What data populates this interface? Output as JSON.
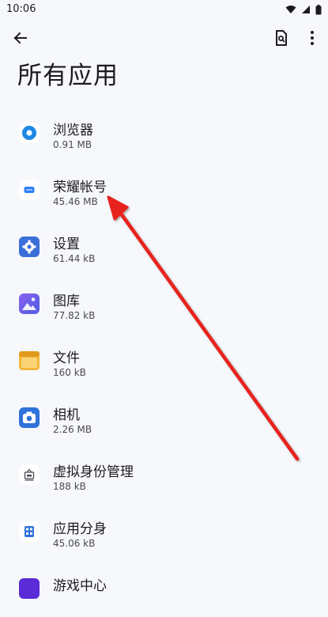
{
  "status_bar": {
    "time": "10:06"
  },
  "toolbar": {
    "back_icon": "arrow-left-icon",
    "search_icon": "search-document-icon",
    "more_icon": "more-vert-icon"
  },
  "page": {
    "title": "所有应用"
  },
  "apps": [
    {
      "name": "浏览器",
      "size": "0.91 MB",
      "icon": "browser-icon",
      "color": "#1e88e5"
    },
    {
      "name": "荣耀帐号",
      "size": "45.46 MB",
      "icon": "honor-account-icon",
      "color": "#2d7ff9"
    },
    {
      "name": "设置",
      "size": "61.44 kB",
      "icon": "settings-icon",
      "color": "#3b6fd8"
    },
    {
      "name": "图库",
      "size": "77.82 kB",
      "icon": "gallery-icon",
      "color": "#6b5ce7"
    },
    {
      "name": "文件",
      "size": "160 kB",
      "icon": "files-icon",
      "color": "#f4b63a"
    },
    {
      "name": "相机",
      "size": "2.26 MB",
      "icon": "camera-icon",
      "color": "#2f72d9"
    },
    {
      "name": "虚拟身份管理",
      "size": "188 kB",
      "icon": "virtual-identity-icon",
      "color": "#4a4a52"
    },
    {
      "name": "应用分身",
      "size": "45.06 kB",
      "icon": "app-twin-icon",
      "color": "#2f72d9"
    },
    {
      "name": "游戏中心",
      "size": "",
      "icon": "game-center-icon",
      "color": "#5a2bd6"
    }
  ]
}
